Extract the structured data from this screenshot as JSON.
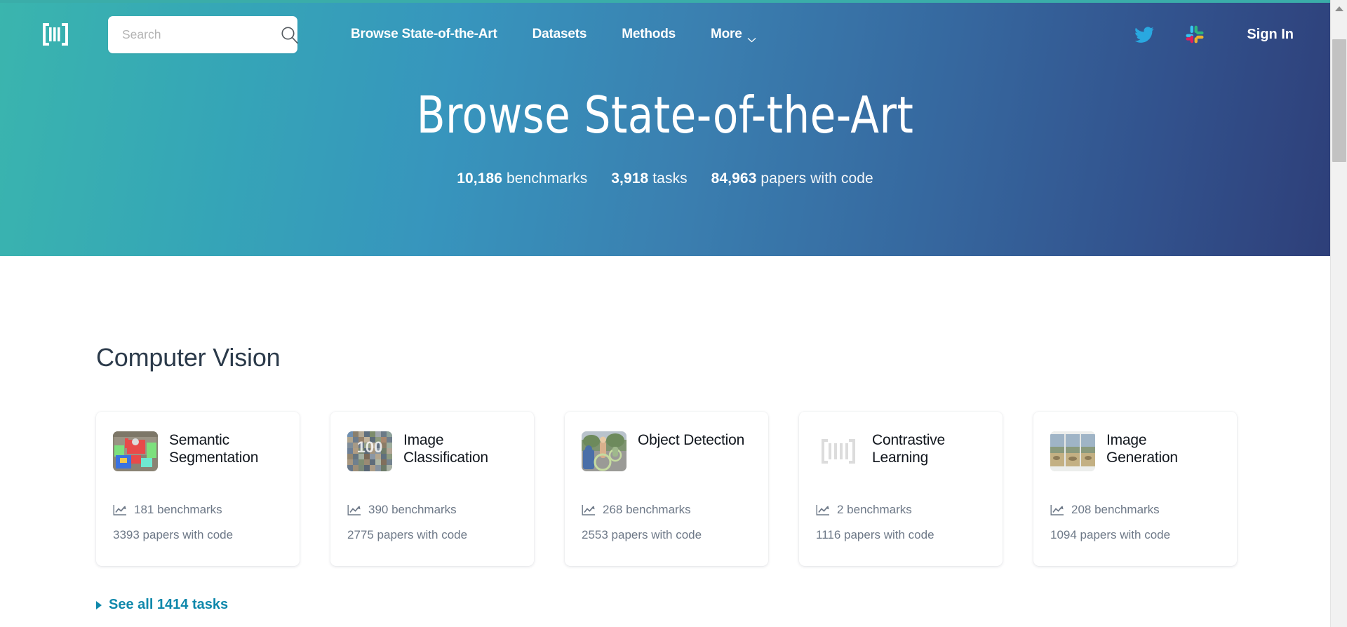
{
  "navbar": {
    "logo_name": "papers-with-code-logo",
    "search": {
      "placeholder": "Search",
      "value": "",
      "icon": "search-icon"
    },
    "links": [
      {
        "label": "Browse State-of-the-Art",
        "has_chevron": false
      },
      {
        "label": "Datasets",
        "has_chevron": false
      },
      {
        "label": "Methods",
        "has_chevron": false
      },
      {
        "label": "More",
        "has_chevron": true
      }
    ],
    "twitter_icon": "twitter-icon",
    "slack_icon": "slack-icon",
    "signin_label": "Sign In"
  },
  "hero": {
    "title": "Browse State-of-the-Art",
    "stats": [
      {
        "number": "10,186",
        "label": "benchmarks"
      },
      {
        "number": "3,918",
        "label": "tasks"
      },
      {
        "number": "84,963",
        "label": "papers with code"
      }
    ]
  },
  "main": {
    "section_title": "Computer Vision",
    "cards": [
      {
        "title": "Semantic Segmentation",
        "benchmarks": "181 benchmarks",
        "papers": "3393 papers with code",
        "thumb": "semantic-segmentation-thumbnail"
      },
      {
        "title": "Image Classification",
        "benchmarks": "390 benchmarks",
        "papers": "2775 papers with code",
        "thumb": "image-classification-thumbnail"
      },
      {
        "title": "Object Detection",
        "benchmarks": "268 benchmarks",
        "papers": "2553 papers with code",
        "thumb": "object-detection-thumbnail"
      },
      {
        "title": "Contrastive Learning",
        "benchmarks": "2 benchmarks",
        "papers": "1116 papers with code",
        "thumb": "placeholder-logo-thumbnail"
      },
      {
        "title": "Image Generation",
        "benchmarks": "208 benchmarks",
        "papers": "1094 papers with code",
        "thumb": "image-generation-thumbnail"
      }
    ],
    "see_all_label": "See all 1414 tasks"
  },
  "colors": {
    "gradient_start": "#3ab5ae",
    "gradient_end": "#2e3f79",
    "link_teal": "#0f88ab",
    "muted_text": "#6d7887",
    "heading": "#2b3a4a"
  }
}
